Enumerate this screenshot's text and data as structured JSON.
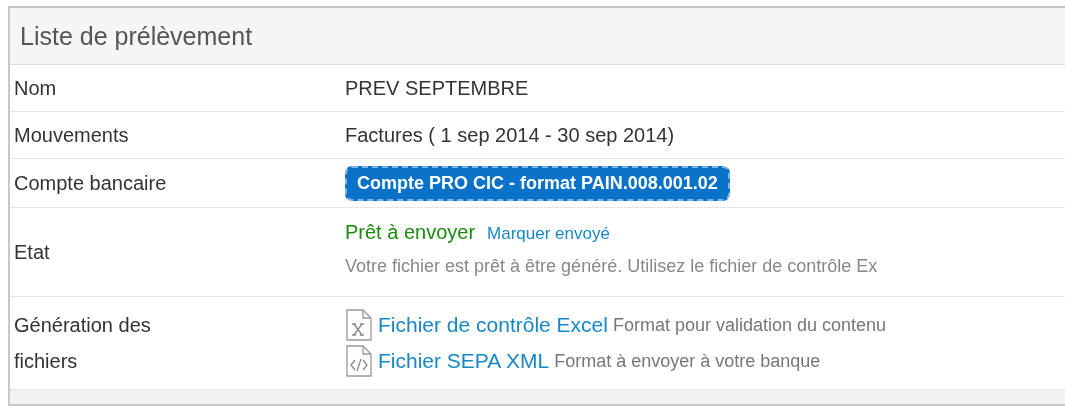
{
  "panel": {
    "title": "Liste de prélèvement"
  },
  "rows": [
    {
      "kind": "text",
      "label": "Nom",
      "value": "PREV SEPTEMBRE"
    },
    {
      "kind": "text",
      "label": "Mouvements",
      "value": "Factures ( 1 sep 2014 - 30 sep 2014)"
    },
    {
      "kind": "badge",
      "label": "Compte bancaire",
      "value": "Compte PRO CIC - format PAIN.008.001.02"
    },
    {
      "kind": "status",
      "label": "Etat",
      "status": "Prêt à envoyer",
      "link": "Marquer envoyé",
      "note": "Votre fichier est prêt à être généré. Utilisez le fichier de contrôle Ex"
    },
    {
      "kind": "files",
      "label": "Génération des fichiers",
      "files": [
        {
          "kind": "excel",
          "name": "Fichier de contrôle Excel",
          "description": "Format pour validation du contenu"
        },
        {
          "kind": "xml",
          "name": "Fichier SEPA XML",
          "description": "Format à envoyer à votre banque"
        }
      ]
    }
  ]
}
